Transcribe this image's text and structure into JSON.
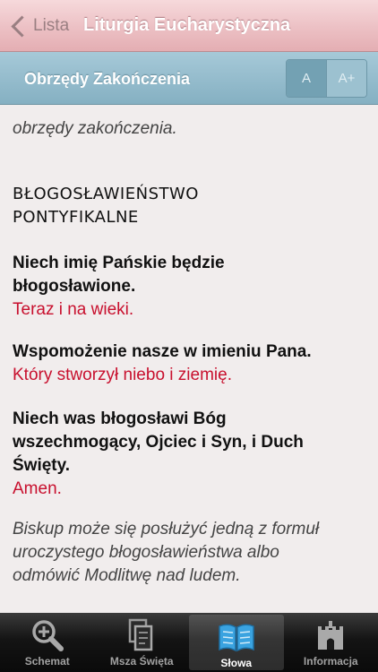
{
  "navbar": {
    "back_label": "Lista",
    "title": "Liturgia Eucharystyczna"
  },
  "section_header": {
    "title": "Obrzędy Zakończenia",
    "font_smaller": "A",
    "font_larger": "A+"
  },
  "content": {
    "intro": "obrzędy zakończenia.",
    "heading_line1": "BŁOGOSŁAWIEŃSTWO",
    "heading_line2": "PONTYFIKALNE",
    "block1": {
      "priest_line1": "Niech imię Pańskie będzie",
      "priest_line2": "błogosławione.",
      "response": "Teraz i na wieki."
    },
    "block2": {
      "priest_line1": "Wspomożenie nasze w imieniu Pana.",
      "response": "Który stworzył niebo i ziemię."
    },
    "block3": {
      "priest_line1": "Niech was błogosławi Bóg",
      "priest_line2": "wszechmogący, Ojciec i Syn, i Duch",
      "priest_line3": "Święty.",
      "response": "Amen."
    },
    "rubric": {
      "line1": "Biskup może się posłużyć jedną z formuł",
      "line2": "uroczystego błogosławieństwa albo",
      "line3": "odmówić Modlitwę nad ludem."
    }
  },
  "tabbar": {
    "tabs": [
      {
        "label": "Schemat",
        "icon": "magnifier-plus-icon"
      },
      {
        "label": "Msza Święta",
        "icon": "pages-icon"
      },
      {
        "label": "Słowa",
        "icon": "open-book-icon",
        "active": true
      },
      {
        "label": "Informacja",
        "icon": "castle-icon"
      }
    ]
  },
  "colors": {
    "navbar": "#ecc0c4",
    "section_header": "#85b0c2",
    "response_red": "#c8102e",
    "background": "#f1eded",
    "active_tab_icon": "#3aa3e0"
  }
}
